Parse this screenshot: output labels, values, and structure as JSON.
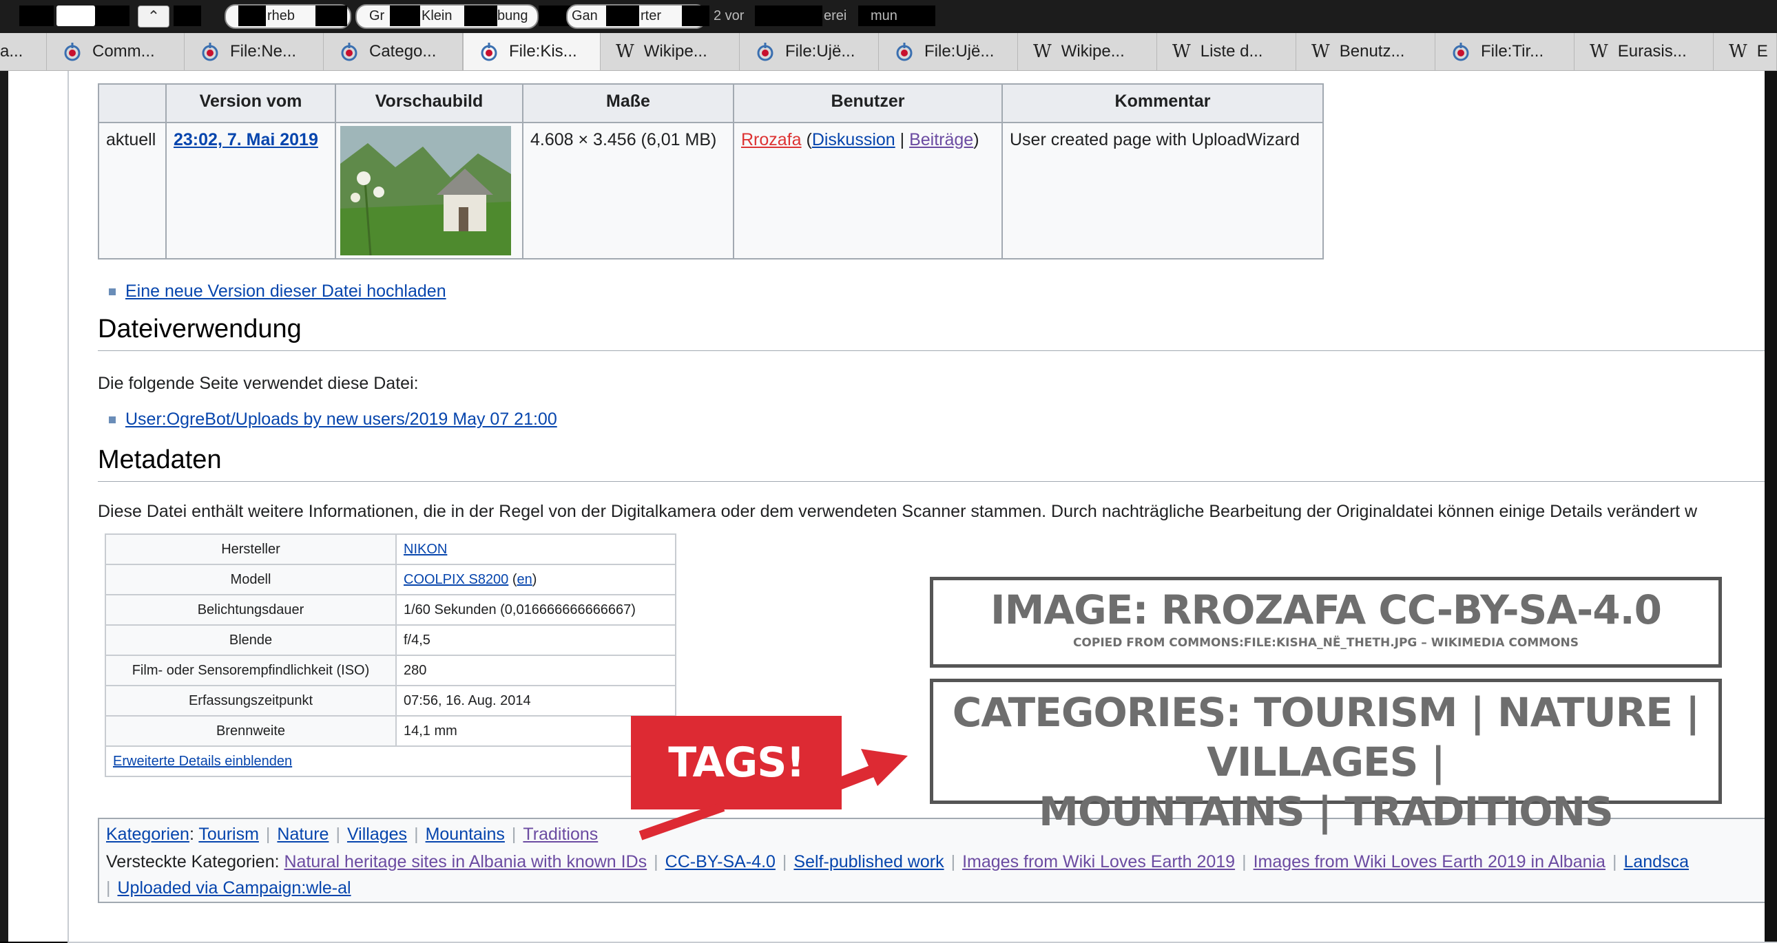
{
  "find_bar": {
    "fragments": [
      "rheb",
      "Gr",
      "Klein",
      "bung",
      "Gan",
      "rter",
      "2 vor",
      "erei",
      "mun"
    ]
  },
  "tabs": [
    {
      "label": "a...",
      "icon": "none"
    },
    {
      "label": "Comm...",
      "icon": "commons-icon"
    },
    {
      "label": "File:Ne...",
      "icon": "commons-icon"
    },
    {
      "label": "Catego...",
      "icon": "commons-icon"
    },
    {
      "label": "File:Kis...",
      "icon": "commons-icon",
      "active": true
    },
    {
      "label": "Wikipe...",
      "icon": "wikipedia-icon"
    },
    {
      "label": "File:Ujë...",
      "icon": "commons-icon"
    },
    {
      "label": "File:Ujë...",
      "icon": "commons-icon"
    },
    {
      "label": "Wikipe...",
      "icon": "wikipedia-icon"
    },
    {
      "label": "Liste d...",
      "icon": "wikipedia-icon"
    },
    {
      "label": "Benutz...",
      "icon": "wikipedia-icon"
    },
    {
      "label": "File:Tir...",
      "icon": "commons-icon"
    },
    {
      "label": "Eurasis...",
      "icon": "wikipedia-icon"
    },
    {
      "label": "E",
      "icon": "wikipedia-icon"
    }
  ],
  "history": {
    "headers": [
      "",
      "Version vom",
      "Vorschaubild",
      "Maße",
      "Benutzer",
      "Kommentar"
    ],
    "row": {
      "status": "aktuell",
      "date": "23:02, 7. Mai 2019",
      "size": "4.608 × 3.456 (6,01 MB)",
      "user": "Rrozafa",
      "user_talk": "Diskussion",
      "user_contribs": "Beiträge",
      "comment": "User created page with UploadWizard"
    },
    "upload_new": "Eine neue Version dieser Datei hochladen"
  },
  "usage": {
    "heading": "Dateiverwendung",
    "intro": "Die folgende Seite verwendet diese Datei:",
    "link": "User:OgreBot/Uploads by new users/2019 May 07 21:00"
  },
  "metadata": {
    "heading": "Metadaten",
    "intro": "Diese Datei enthält weitere Informationen, die in der Regel von der Digitalkamera oder dem verwendeten Scanner stammen. Durch nachträgliche Bearbeitung der Originaldatei können einige Details verändert w",
    "rows": [
      {
        "key": "Hersteller",
        "value": "NIKON",
        "link": true
      },
      {
        "key": "Modell",
        "value": "COOLPIX S8200",
        "extra": "en",
        "link": true
      },
      {
        "key": "Belichtungsdauer",
        "value": "1/60 Sekunden (0,016666666666667)"
      },
      {
        "key": "Blende",
        "value": "f/4,5"
      },
      {
        "key": "Film- oder Sensorempfindlichkeit (ISO)",
        "value": "280"
      },
      {
        "key": "Erfassungszeitpunkt",
        "value": "07:56, 16. Aug. 2014"
      },
      {
        "key": "Brennweite",
        "value": "14,1 mm"
      }
    ],
    "expand": "Erweiterte Details einblenden"
  },
  "categories": {
    "label": "Kategorien",
    "items": [
      "Tourism",
      "Nature",
      "Villages",
      "Mountains",
      "Traditions"
    ],
    "hidden_label": "Versteckte Kategorien:",
    "hidden_items": [
      "Natural heritage sites in Albania with known IDs",
      "CC-BY-SA-4.0",
      "Self-published work",
      "Images from Wiki Loves Earth 2019",
      "Images from Wiki Loves Earth 2019 in Albania",
      "Landsca"
    ],
    "hidden_line2": "Uploaded via Campaign:wle-al"
  },
  "overlay": {
    "credit_title": "IMAGE: RROZAFA CC-BY-SA-4.0",
    "credit_sub": "COPIED FROM COMMONS:FILE:KISHA_NË_THETH.JPG – WIKIMEDIA COMMONS",
    "categories_line1": "CATEGORIES: TOURISM | NATURE | VILLAGES |",
    "categories_line2": "MOUNTAINS | TRADITIONS",
    "tag_label": "TAGS!",
    "colors": {
      "banner": "#dd2a33",
      "box_text": "#6e6e6e"
    }
  }
}
